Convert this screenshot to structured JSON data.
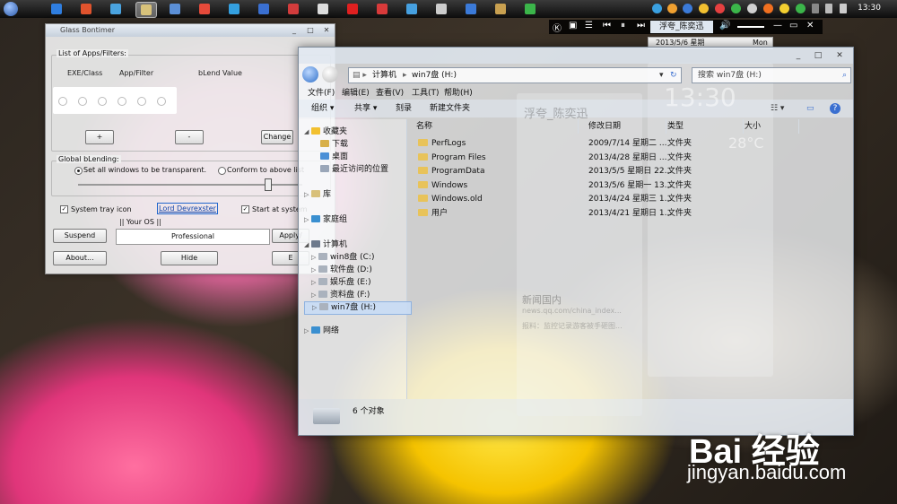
{
  "taskbar": {
    "clock": "13:30",
    "apps": [
      {
        "name": "ie",
        "color": "#2f7ee0"
      },
      {
        "name": "office",
        "color": "#e0532d"
      },
      {
        "name": "display",
        "color": "#4aa3df"
      },
      {
        "name": "explorer",
        "color": "#d8c27a",
        "active": true
      },
      {
        "name": "ball",
        "color": "#5b8fd6"
      },
      {
        "name": "chrome",
        "color": "#e64a3a"
      },
      {
        "name": "qq",
        "color": "#34a0e0"
      },
      {
        "name": "vector",
        "color": "#3a6fd0"
      },
      {
        "name": "tool-red",
        "color": "#d23c3c"
      },
      {
        "name": "tools",
        "color": "#dddddd"
      },
      {
        "name": "arrow-red",
        "color": "#e02020"
      },
      {
        "name": "pdf",
        "color": "#d83a3a"
      },
      {
        "name": "circle",
        "color": "#46a0e0"
      },
      {
        "name": "wrench",
        "color": "#cccccc"
      },
      {
        "name": "blue-app",
        "color": "#3b7ad8"
      },
      {
        "name": "picture",
        "color": "#c8a050"
      },
      {
        "name": "green-circle",
        "color": "#3bb54a"
      }
    ]
  },
  "media": {
    "title": "浮夸_陈奕迅"
  },
  "calendar": {
    "date": "2013/5/6 星期",
    "day": "Mon"
  },
  "blend": {
    "title": "Glass Bontimer",
    "apps_group": "List of Apps/Filters:",
    "columns": [
      "EXE/Class",
      "App/Filter",
      "bLend Value"
    ],
    "add_btn": "+",
    "remove_btn": "-",
    "change_btn": "Change",
    "global_group": "Global bLending:",
    "radio_all": "Set all windows to be transparent.",
    "radio_list": "Conform to above list",
    "tray_icon": "System tray icon",
    "author_link": "Lord Devrexster",
    "start_at_system": "Start at system",
    "os_group": "|| Your OS ||",
    "os_value": "Professional",
    "suspend_btn": "Suspend",
    "apply_btn": "Apply/",
    "about_btn": "About...",
    "hide_btn": "Hide",
    "exit_btn": "E"
  },
  "explorer": {
    "address": [
      "计算机",
      "win7盘 (H:)"
    ],
    "search_placeholder": "搜索 win7盘 (H:)",
    "menu": [
      "文件(F)",
      "编辑(E)",
      "查看(V)",
      "工具(T)",
      "帮助(H)"
    ],
    "commands": [
      "组织",
      "共享",
      "刻录",
      "新建文件夹"
    ],
    "nav": {
      "favorites": "收藏夹",
      "downloads": "下载",
      "desktop": "桌面",
      "recent": "最近访问的位置",
      "libraries": "库",
      "homegroup": "家庭组",
      "computer": "计算机",
      "drives": [
        "win8盘 (C:)",
        "软件盘 (D:)",
        "娱乐盘 (E:)",
        "资料盘 (F:)",
        "win7盘 (H:)"
      ],
      "network": "网络"
    },
    "columns": [
      "名称",
      "修改日期",
      "类型",
      "大小"
    ],
    "rows": [
      {
        "name": "PerfLogs",
        "date": "2009/7/14 星期二 ...",
        "type": "文件夹"
      },
      {
        "name": "Program Files",
        "date": "2013/4/28 星期日 ...",
        "type": "文件夹"
      },
      {
        "name": "ProgramData",
        "date": "2013/5/5 星期日 22...",
        "type": "文件夹"
      },
      {
        "name": "Windows",
        "date": "2013/5/6 星期一 13...",
        "type": "文件夹"
      },
      {
        "name": "Windows.old",
        "date": "2013/4/24 星期三 1...",
        "type": "文件夹"
      },
      {
        "name": "用户",
        "date": "2013/4/21 星期日 1...",
        "type": "文件夹"
      }
    ],
    "status": "6 个对象"
  },
  "widgets": {
    "title": "浮夸_陈奕迅",
    "time": "13:30",
    "temp": "28°C",
    "news_title": "新闻国内",
    "news_url": "news.qq.com/china_index...",
    "news_text": "报料：监控记录游客被手砸图..."
  },
  "watermark": {
    "logo": "Bai 经验",
    "url": "jingyan.baidu.com"
  }
}
